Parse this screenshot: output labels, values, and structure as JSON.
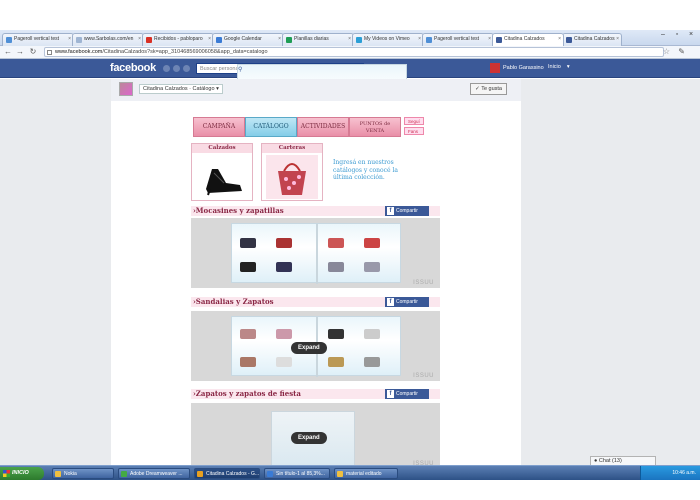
{
  "browser": {
    "tabs": [
      {
        "label": "Pageroll vertical test",
        "color": "#4f8fd6"
      },
      {
        "label": "www.Sarbolas.com/en",
        "color": "#9fb5d3"
      },
      {
        "label": "Recibidos - pabloparo",
        "color": "#d93025"
      },
      {
        "label": "Google Calendar",
        "color": "#3a7bd5"
      },
      {
        "label": "Planillas diarias",
        "color": "#1f9d55"
      },
      {
        "label": "My Videos on Vimeo",
        "color": "#2b9fd6"
      },
      {
        "label": "Pageroll vertical test",
        "color": "#4f8fd6"
      },
      {
        "label": "Citadina Calzados",
        "color": "#3b5998",
        "active": true
      },
      {
        "label": "Citadina Calzados",
        "color": "#3b5998"
      }
    ],
    "url_domain": "www.facebook.com",
    "url_path": "/CitadinaCalzados?sk=app_310468569006058&app_data=catalogo"
  },
  "fb": {
    "logo": "facebook",
    "search_placeholder": "Buscar personas, lugares y cosas",
    "user_name": "Pablo Garassino",
    "home": "Inicio",
    "page_title": "Citadina Calzados · Catálogo",
    "like_button": "✓ Te gusta"
  },
  "catalog": {
    "nav": [
      "CAMPAÑA",
      "CATÁLOGO",
      "ACTIVIDADES",
      "PUNTOS de VENTA"
    ],
    "social": [
      "Seguí",
      "Fans"
    ],
    "categories": [
      "Calzados",
      "Carteras"
    ],
    "promo": "Ingresá en nuestros catálogos y conocé la última colección.",
    "sections": [
      {
        "title": "›Mocasines y zapatillas",
        "share": "Compartir"
      },
      {
        "title": "›Sandalias y Zapatos",
        "share": "Compartir",
        "expand": "Expand"
      },
      {
        "title": "›Zapatos y zapatos de fiesta",
        "share": "Compartir",
        "expand": "Expand"
      }
    ],
    "issuu": "ISSUU"
  },
  "taskbar": {
    "start": "INICIO",
    "items": [
      {
        "label": "Nokia",
        "color": "#f0c040"
      },
      {
        "label": "Adobe Dreamweaver ...",
        "color": "#44aa44"
      },
      {
        "label": "Citadina Calzados - G...",
        "color": "#e8a020",
        "active": true
      },
      {
        "label": "Sin título-1 al 85,3%...",
        "color": "#3a7bd5"
      },
      {
        "label": "material editado",
        "color": "#f0c040"
      }
    ],
    "clock": "10:46 a.m."
  },
  "chat": "Chat (13)"
}
